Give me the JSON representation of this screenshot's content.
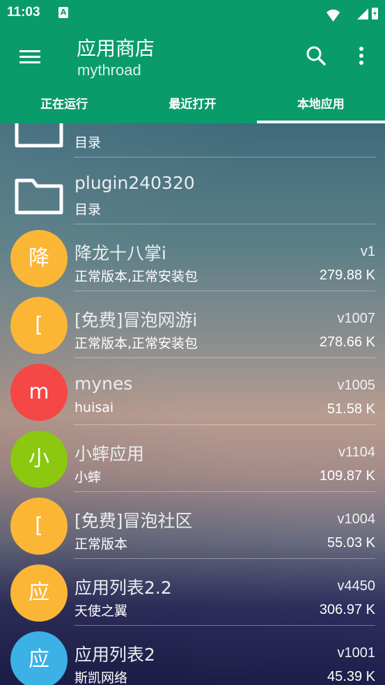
{
  "status": {
    "time": "11:03",
    "notif": "A"
  },
  "app": {
    "title": "应用商店",
    "subtitle": "mythroad"
  },
  "tabs": [
    {
      "label": "正在运行",
      "active": false
    },
    {
      "label": "最近打开",
      "active": false
    },
    {
      "label": "本地应用",
      "active": true
    }
  ],
  "list": [
    {
      "type": "folder",
      "name": "",
      "sub": "目录"
    },
    {
      "type": "folder",
      "name": "plugin240320",
      "sub": "目录"
    },
    {
      "type": "app",
      "initial": "降",
      "color": "#fbb636",
      "name": "降龙十八掌i",
      "sub": "正常版本,正常安装包",
      "version": "v1",
      "size": "279.88 K"
    },
    {
      "type": "app",
      "initial": "[",
      "color": "#fbb636",
      "name": "[免费]冒泡网游i",
      "sub": "正常版本,正常安装包",
      "version": "v1007",
      "size": "278.66 K"
    },
    {
      "type": "app",
      "initial": "m",
      "color": "#f44746",
      "name": "mynes",
      "sub": "huisai",
      "version": "v1005",
      "size": "51.58 K"
    },
    {
      "type": "app",
      "initial": "小",
      "color": "#8bc80f",
      "name": "小蟀应用",
      "sub": "小蟀",
      "version": "v1104",
      "size": "109.87 K"
    },
    {
      "type": "app",
      "initial": "[",
      "color": "#fbb636",
      "name": "[免费]冒泡社区",
      "sub": "正常版本",
      "version": "v1004",
      "size": "55.03 K"
    },
    {
      "type": "app",
      "initial": "应",
      "color": "#fbb636",
      "name": "应用列表2.2",
      "sub": "天使之翼",
      "version": "v4450",
      "size": "306.97 K"
    },
    {
      "type": "app",
      "initial": "应",
      "color": "#3bb1e6",
      "name": "应用列表2",
      "sub": "斯凯网络",
      "version": "v1001",
      "size": "45.39 K"
    }
  ]
}
